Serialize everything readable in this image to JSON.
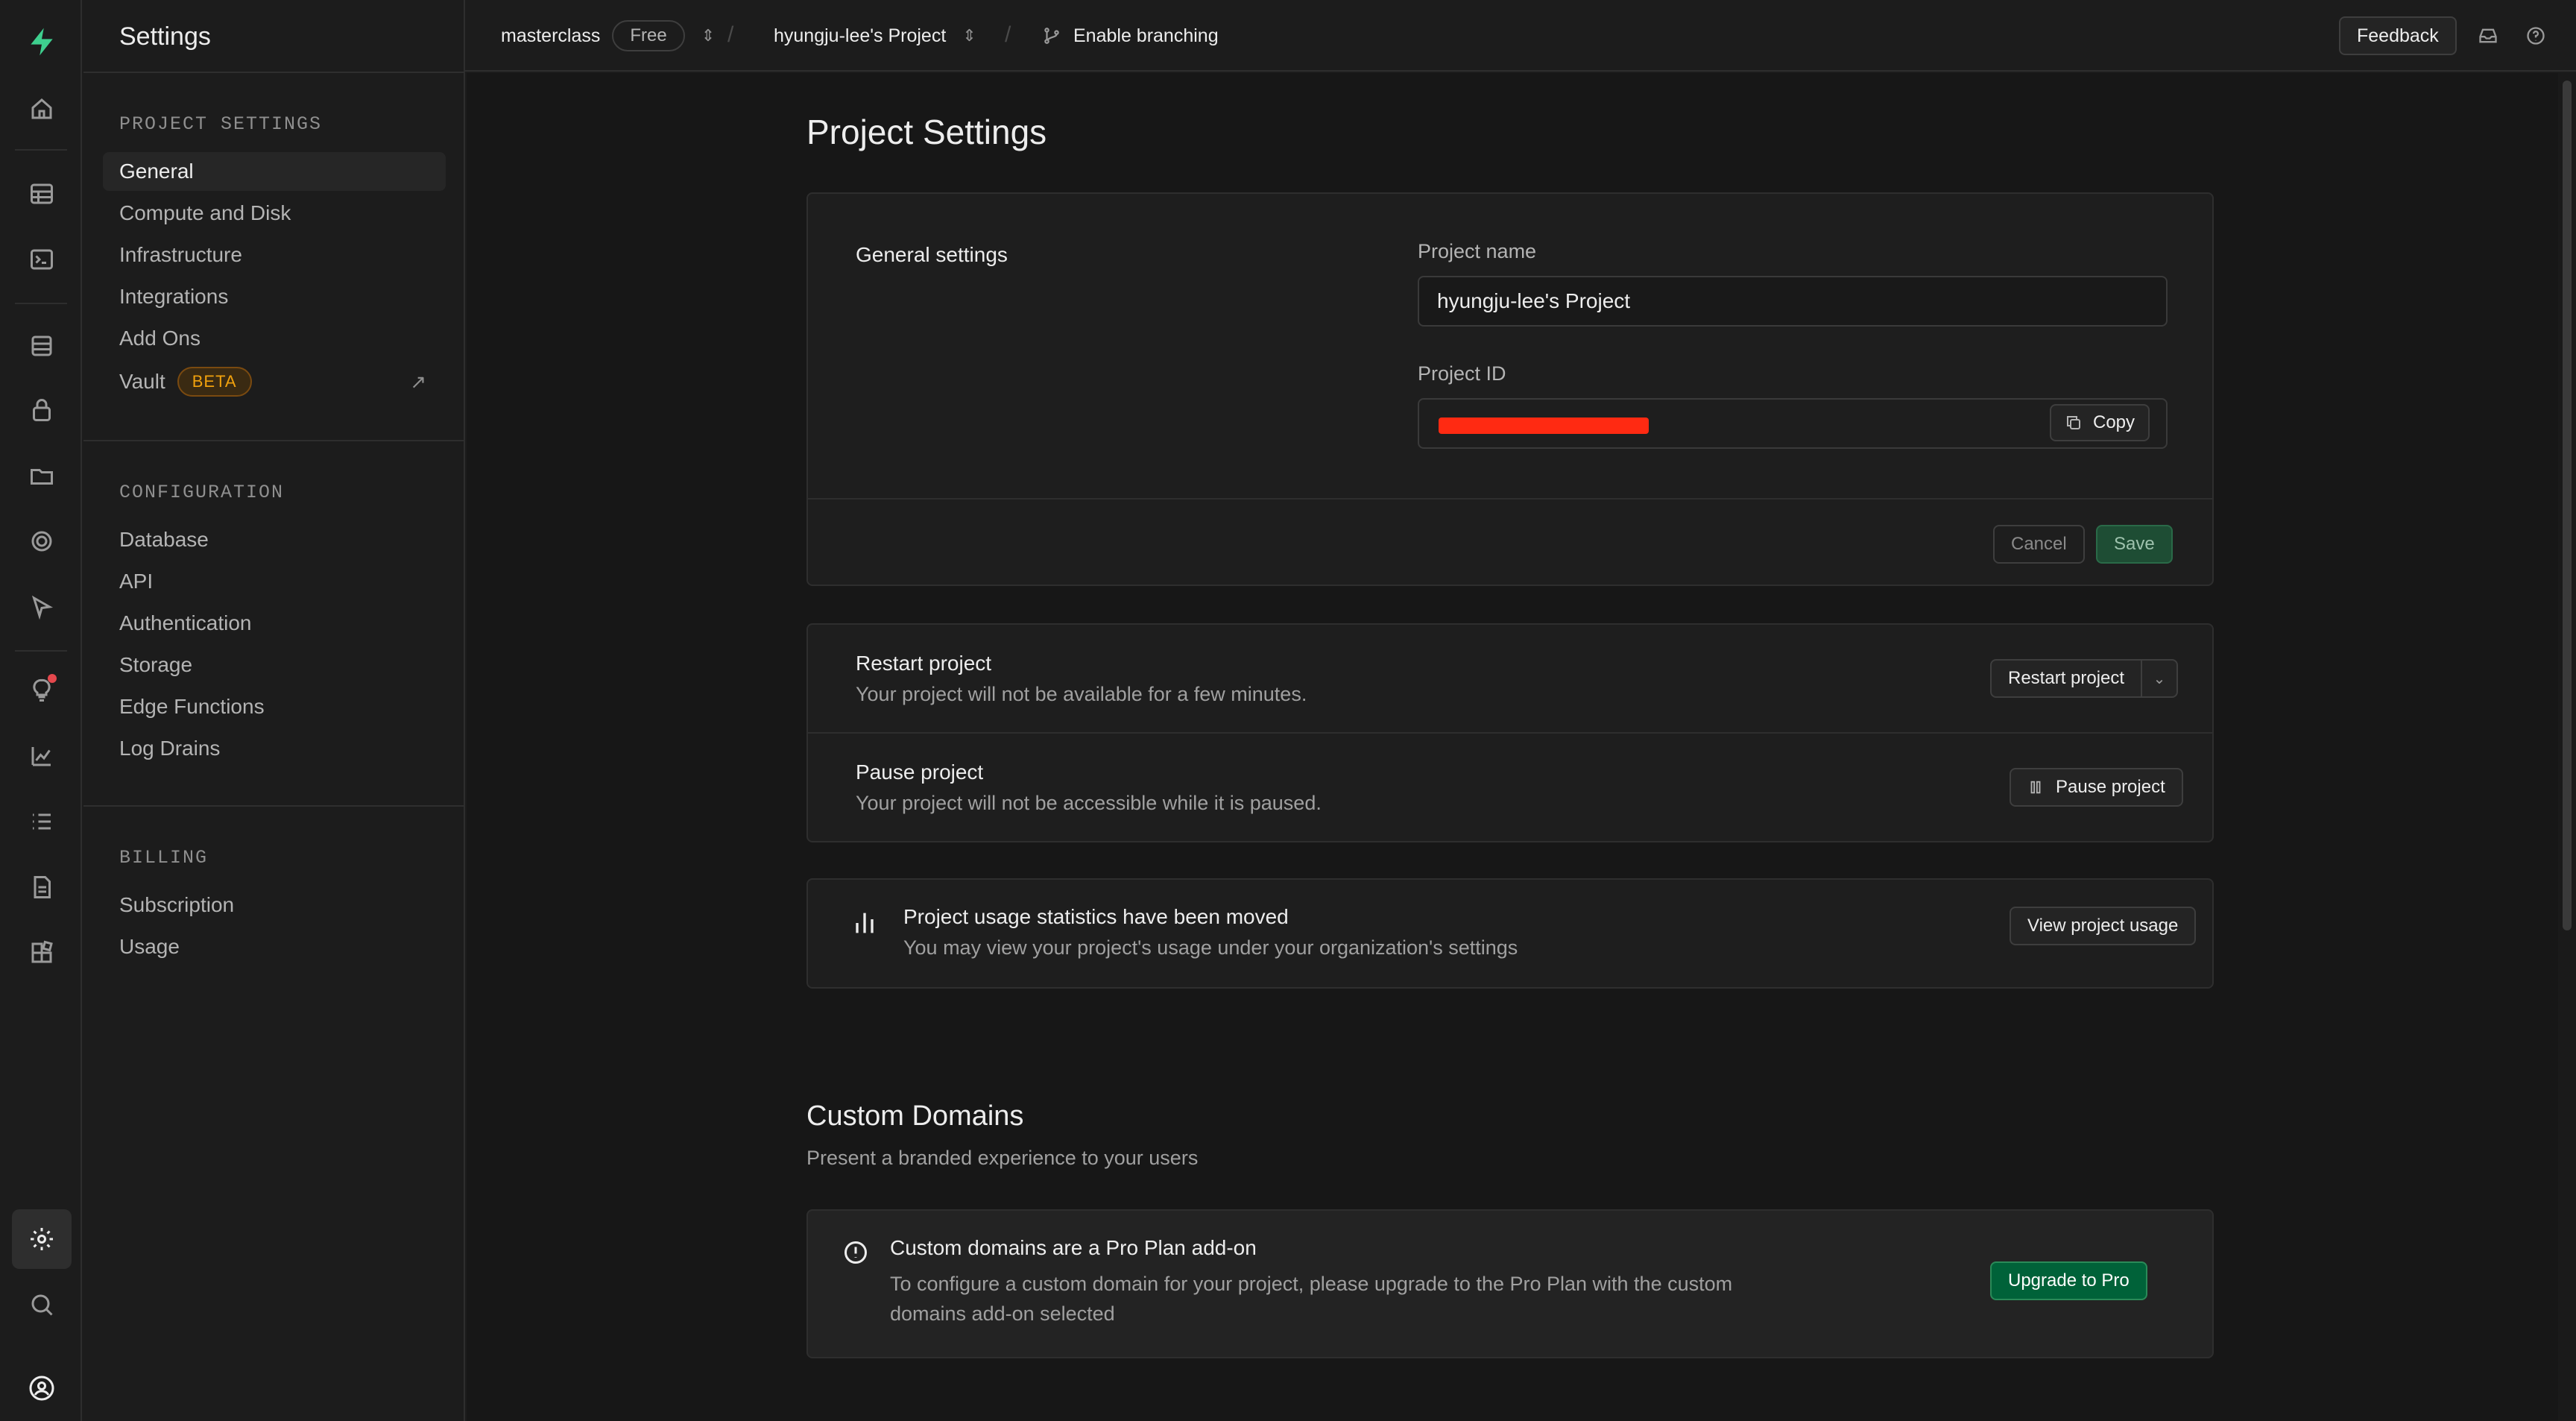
{
  "colors": {
    "brand": "#3ecf8e",
    "background": "#171717",
    "accent_green": "#006239",
    "beta": "#f1a10d"
  },
  "rail": {
    "icons": [
      "supabase-logo-icon",
      "home-icon",
      "table-editor-icon",
      "sql-editor-icon",
      "database-icon",
      "auth-lock-icon",
      "storage-icon",
      "realtime-icon",
      "edge-functions-icon",
      "advisors-icon",
      "reports-icon",
      "logs-icon",
      "api-docs-icon",
      "integrations-icon",
      "settings-icon",
      "search-icon",
      "user-avatar-icon"
    ]
  },
  "sidebar": {
    "title": "Settings",
    "project_settings": {
      "label": "PROJECT SETTINGS",
      "items": [
        "General",
        "Compute and Disk",
        "Infrastructure",
        "Integrations",
        "Add Ons",
        "Vault"
      ],
      "vault_badge": "BETA",
      "external_link_icon": "↗"
    },
    "configuration": {
      "label": "CONFIGURATION",
      "items": [
        "Database",
        "API",
        "Authentication",
        "Storage",
        "Edge Functions",
        "Log Drains"
      ]
    },
    "billing": {
      "label": "BILLING",
      "items": [
        "Subscription",
        "Usage"
      ]
    }
  },
  "topbar": {
    "org": "masterclass",
    "plan": "Free",
    "project": "hyungju-lee's Project",
    "branching": "Enable branching",
    "feedback": "Feedback"
  },
  "main": {
    "title": "Project Settings",
    "general": {
      "heading": "General settings",
      "project_name_label": "Project name",
      "project_name_value": "hyungju-lee's Project",
      "project_id_label": "Project ID",
      "copy_label": "Copy",
      "cancel_label": "Cancel",
      "save_label": "Save"
    },
    "restart": {
      "title": "Restart project",
      "desc": "Your project will not be available for a few minutes.",
      "button": "Restart project"
    },
    "pause": {
      "title": "Pause project",
      "desc": "Your project will not be accessible while it is paused.",
      "button": "Pause project"
    },
    "usage": {
      "title": "Project usage statistics have been moved",
      "desc": "You may view your project's usage under your organization's settings",
      "button": "View project usage"
    },
    "custom_domains": {
      "title": "Custom Domains",
      "subtitle": "Present a branded experience to your users",
      "notice_title": "Custom domains are a Pro Plan add-on",
      "notice_desc_1": "To configure a custom domain for your project, please upgrade to the Pro Plan with the custom",
      "notice_desc_2": "domains add-on selected",
      "button": "Upgrade to Pro"
    }
  }
}
